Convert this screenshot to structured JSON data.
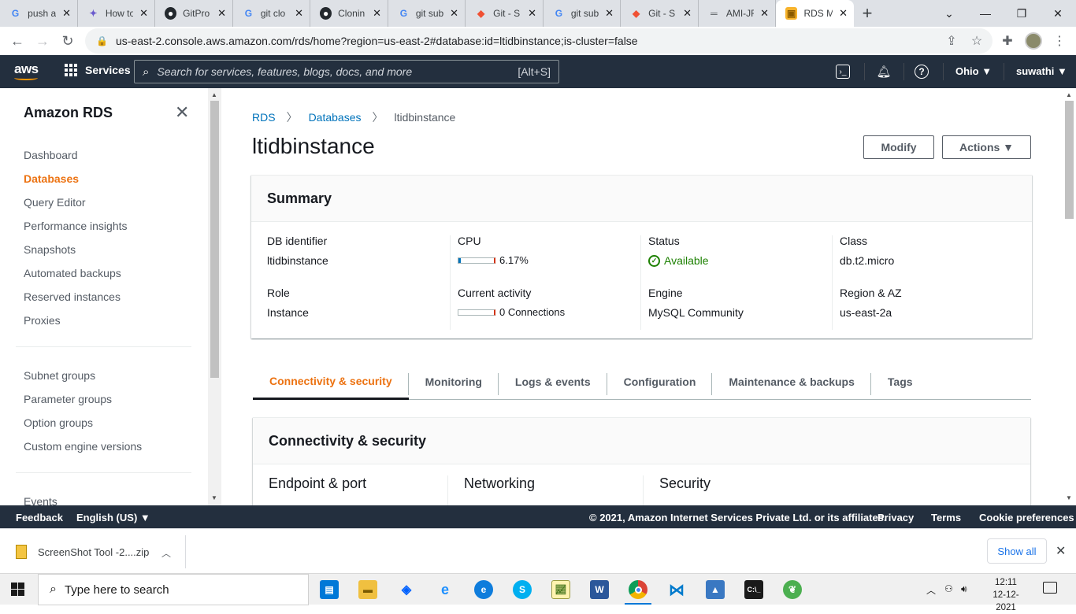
{
  "browser": {
    "tabs": [
      {
        "label": "push a",
        "icon": "google-icon"
      },
      {
        "label": "How to",
        "icon": "stack-icon"
      },
      {
        "label": "GitPro",
        "icon": "github-icon"
      },
      {
        "label": "git clo",
        "icon": "google-icon"
      },
      {
        "label": "Clonin",
        "icon": "github-icon"
      },
      {
        "label": "git sub",
        "icon": "google-icon"
      },
      {
        "label": "Git - S",
        "icon": "git-icon"
      },
      {
        "label": "git sub",
        "icon": "google-icon"
      },
      {
        "label": "Git - S",
        "icon": "git-icon"
      },
      {
        "label": "AMI-JF",
        "icon": "doc-icon"
      },
      {
        "label": "RDS M",
        "icon": "rds-icon",
        "active": true
      }
    ],
    "url": "us-east-2.console.aws.amazon.com/rds/home?region=us-east-2#database:id=ltidbinstance;is-cluster=false"
  },
  "aws_nav": {
    "services": "Services",
    "search_placeholder": "Search for services, features, blogs, docs, and more",
    "search_shortcut": "[Alt+S]",
    "region": "Ohio ▼",
    "user": "suwathi ▼"
  },
  "sidebar": {
    "title": "Amazon RDS",
    "items": [
      "Dashboard",
      "Databases",
      "Query Editor",
      "Performance insights",
      "Snapshots",
      "Automated backups",
      "Reserved instances",
      "Proxies"
    ],
    "items2": [
      "Subnet groups",
      "Parameter groups",
      "Option groups",
      "Custom engine versions"
    ],
    "items3": [
      "Events"
    ],
    "active": "Databases"
  },
  "breadcrumb": {
    "rds": "RDS",
    "databases": "Databases",
    "current": "ltidbinstance"
  },
  "page_title": "ltidbinstance",
  "buttons": {
    "modify": "Modify",
    "actions": "Actions ▼"
  },
  "summary": {
    "title": "Summary",
    "db_identifier_label": "DB identifier",
    "db_identifier": "ltidbinstance",
    "cpu_label": "CPU",
    "cpu_value": "6.17%",
    "cpu_fraction": 0.0617,
    "status_label": "Status",
    "status": "Available",
    "class_label": "Class",
    "class": "db.t2.micro",
    "role_label": "Role",
    "role": "Instance",
    "activity_label": "Current activity",
    "activity": "0 Connections",
    "engine_label": "Engine",
    "engine": "MySQL Community",
    "region_label": "Region & AZ",
    "region": "us-east-2a"
  },
  "detail_tabs": [
    "Connectivity & security",
    "Monitoring",
    "Logs & events",
    "Configuration",
    "Maintenance & backups",
    "Tags"
  ],
  "connectivity": {
    "title": "Connectivity & security",
    "endpoint": "Endpoint & port",
    "networking": "Networking",
    "security": "Security"
  },
  "footer": {
    "feedback": "Feedback",
    "language": "English (US) ▼",
    "copyright": "© 2021, Amazon Internet Services Private Ltd. or its affiliates.",
    "privacy": "Privacy",
    "terms": "Terms",
    "cookies": "Cookie preferences"
  },
  "downloads": {
    "file": "ScreenShot Tool -2....zip",
    "show_all": "Show all"
  },
  "taskbar": {
    "search": "Type here to search",
    "time": "12:11",
    "date": "12-12-2021"
  }
}
